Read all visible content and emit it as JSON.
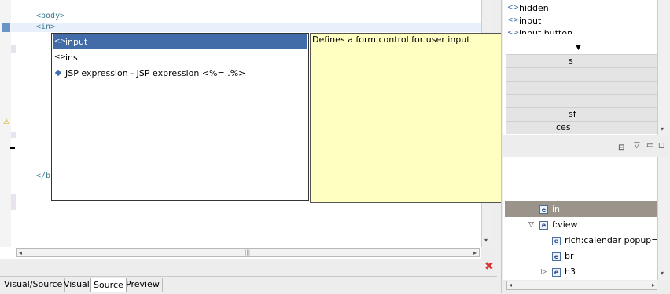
{
  "editor": {
    "lines": [
      "<body>",
      "<in>",
      "</b"
    ]
  },
  "autocomplete": {
    "items": [
      {
        "icon": "<>",
        "label": "input",
        "selected": true
      },
      {
        "icon": "<>",
        "label": "ins",
        "selected": false
      },
      {
        "icon": "jsp-diamond-icon",
        "label": "JSP expression - JSP expression <%=..%>",
        "selected": false
      }
    ],
    "doc": "Defines a form control for user input"
  },
  "bottom_tabs": [
    "Visual/Source",
    "Visual",
    "Source",
    "Preview"
  ],
  "active_tab": "Source",
  "palette": {
    "items": [
      "hidden",
      "input",
      "input button"
    ],
    "bar_texts": [
      "s",
      "sf",
      "ces"
    ]
  },
  "outline": {
    "items": [
      {
        "label": "in",
        "selected": true
      },
      {
        "label": "f:view",
        "selected": false
      },
      {
        "label": "rich:calendar popup=fa",
        "selected": false
      },
      {
        "label": "br",
        "selected": false
      },
      {
        "label": "h3",
        "selected": false
      }
    ]
  }
}
